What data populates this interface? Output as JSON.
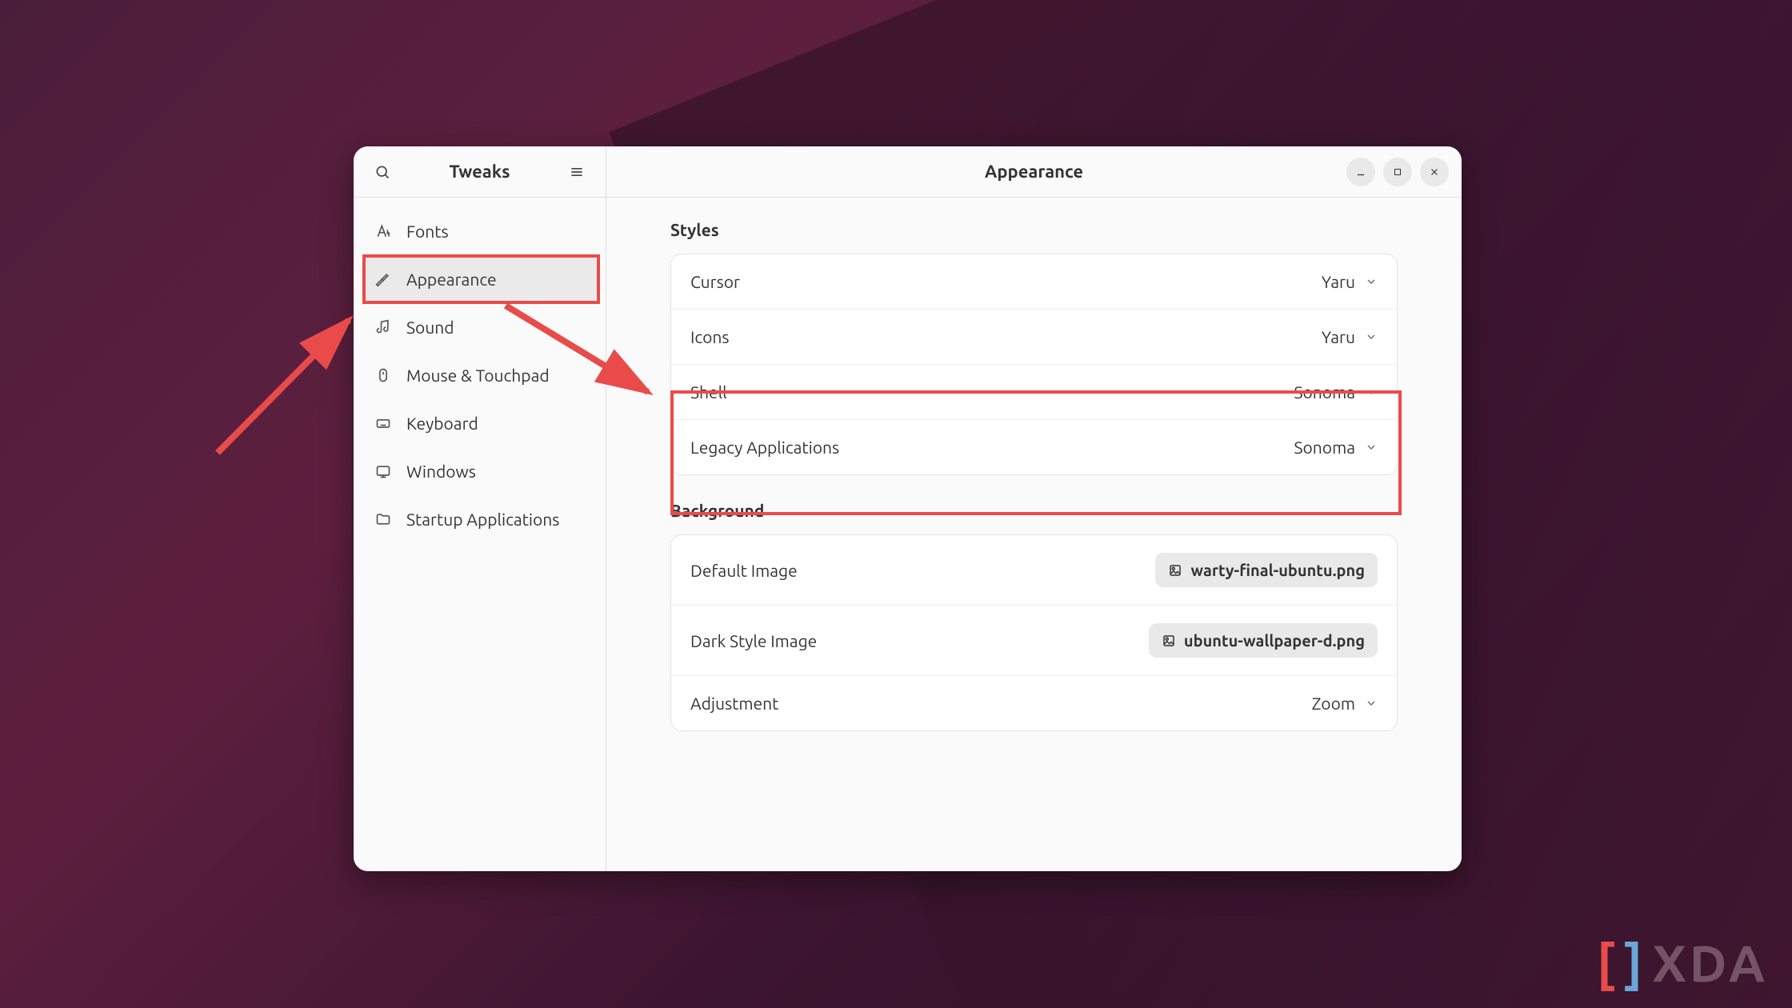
{
  "app_title": "Tweaks",
  "page_title": "Appearance",
  "sidebar": {
    "items": [
      {
        "label": "Fonts",
        "icon": "fonts"
      },
      {
        "label": "Appearance",
        "icon": "appearance",
        "active": true
      },
      {
        "label": "Sound",
        "icon": "sound"
      },
      {
        "label": "Mouse & Touchpad",
        "icon": "mouse"
      },
      {
        "label": "Keyboard",
        "icon": "keyboard"
      },
      {
        "label": "Windows",
        "icon": "windows"
      },
      {
        "label": "Startup Applications",
        "icon": "startup"
      }
    ]
  },
  "sections": {
    "styles": {
      "title": "Styles",
      "rows": [
        {
          "label": "Cursor",
          "value": "Yaru"
        },
        {
          "label": "Icons",
          "value": "Yaru"
        },
        {
          "label": "Shell",
          "value": "Sonoma"
        },
        {
          "label": "Legacy Applications",
          "value": "Sonoma"
        }
      ]
    },
    "background": {
      "title": "Background",
      "rows": [
        {
          "label": "Default Image",
          "file": "warty-final-ubuntu.png"
        },
        {
          "label": "Dark Style Image",
          "file": "ubuntu-wallpaper-d.png"
        },
        {
          "label": "Adjustment",
          "value": "Zoom"
        }
      ]
    }
  },
  "watermark": "XDA"
}
